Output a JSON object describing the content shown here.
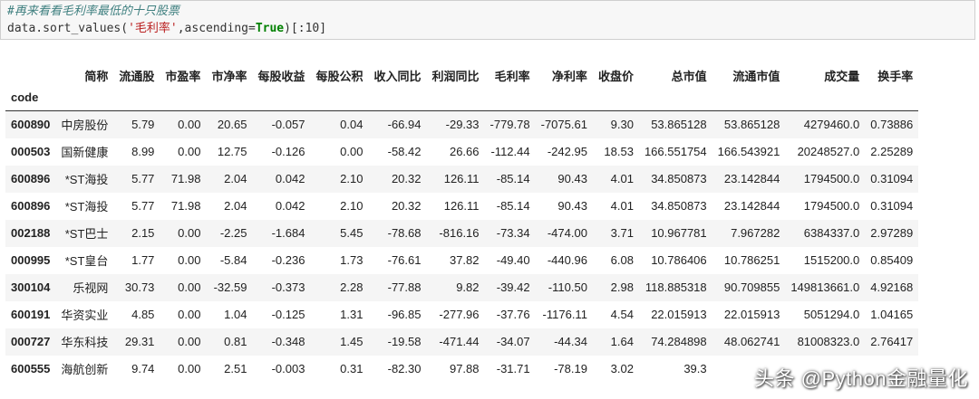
{
  "code": {
    "comment": "#再来看看毛利率最低的十只股票",
    "line2_prefix": "data.sort_values(",
    "line2_string": "'毛利率'",
    "line2_mid": ",ascending=",
    "line2_keyword": "True",
    "line2_suffix": ")[:10]"
  },
  "table": {
    "columns": [
      "简称",
      "流通股",
      "市盈率",
      "市净率",
      "每股收益",
      "每股公积",
      "收入同比",
      "利润同比",
      "毛利率",
      "净利率",
      "收盘价",
      "总市值",
      "流通市值",
      "成交量",
      "换手率"
    ],
    "index_name": "code",
    "rows": [
      {
        "code": "600890",
        "cells": [
          "中房股份",
          "5.79",
          "0.00",
          "20.65",
          "-0.057",
          "0.04",
          "-66.94",
          "-29.33",
          "-779.78",
          "-7075.61",
          "9.30",
          "53.865128",
          "53.865128",
          "4279460.0",
          "0.73886"
        ]
      },
      {
        "code": "000503",
        "cells": [
          "国新健康",
          "8.99",
          "0.00",
          "12.75",
          "-0.126",
          "0.00",
          "-58.42",
          "26.66",
          "-112.44",
          "-242.95",
          "18.53",
          "166.551754",
          "166.543921",
          "20248527.0",
          "2.25289"
        ]
      },
      {
        "code": "600896",
        "cells": [
          "*ST海投",
          "5.77",
          "71.98",
          "2.04",
          "0.042",
          "2.10",
          "20.32",
          "126.11",
          "-85.14",
          "90.43",
          "4.01",
          "34.850873",
          "23.142844",
          "1794500.0",
          "0.31094"
        ]
      },
      {
        "code": "600896",
        "cells": [
          "*ST海投",
          "5.77",
          "71.98",
          "2.04",
          "0.042",
          "2.10",
          "20.32",
          "126.11",
          "-85.14",
          "90.43",
          "4.01",
          "34.850873",
          "23.142844",
          "1794500.0",
          "0.31094"
        ]
      },
      {
        "code": "002188",
        "cells": [
          "*ST巴士",
          "2.15",
          "0.00",
          "-2.25",
          "-1.684",
          "5.45",
          "-78.68",
          "-816.16",
          "-73.34",
          "-474.00",
          "3.71",
          "10.967781",
          "7.967282",
          "6384337.0",
          "2.97289"
        ]
      },
      {
        "code": "000995",
        "cells": [
          "*ST皇台",
          "1.77",
          "0.00",
          "-5.84",
          "-0.236",
          "1.73",
          "-76.61",
          "37.82",
          "-49.40",
          "-440.96",
          "6.08",
          "10.786406",
          "10.786251",
          "1515200.0",
          "0.85409"
        ]
      },
      {
        "code": "300104",
        "cells": [
          "乐视网",
          "30.73",
          "0.00",
          "-32.59",
          "-0.373",
          "2.28",
          "-77.88",
          "9.82",
          "-39.42",
          "-110.50",
          "2.98",
          "118.885318",
          "90.709855",
          "149813661.0",
          "4.92168"
        ]
      },
      {
        "code": "600191",
        "cells": [
          "华资实业",
          "4.85",
          "0.00",
          "1.04",
          "-0.125",
          "1.31",
          "-96.85",
          "-277.96",
          "-37.76",
          "-1176.11",
          "4.54",
          "22.015913",
          "22.015913",
          "5051294.0",
          "1.04165"
        ]
      },
      {
        "code": "000727",
        "cells": [
          "华东科技",
          "29.31",
          "0.00",
          "0.81",
          "-0.348",
          "1.45",
          "-19.58",
          "-471.44",
          "-34.07",
          "-44.34",
          "1.64",
          "74.284898",
          "48.062741",
          "81008323.0",
          "2.76417"
        ]
      },
      {
        "code": "600555",
        "cells": [
          "海航创新",
          "9.74",
          "0.00",
          "2.51",
          "-0.003",
          "0.31",
          "-82.30",
          "97.88",
          "-31.71",
          "-78.19",
          "3.02",
          "39.3",
          "",
          "",
          ""
        ]
      }
    ]
  },
  "watermark": "头条 @Python金融量化"
}
